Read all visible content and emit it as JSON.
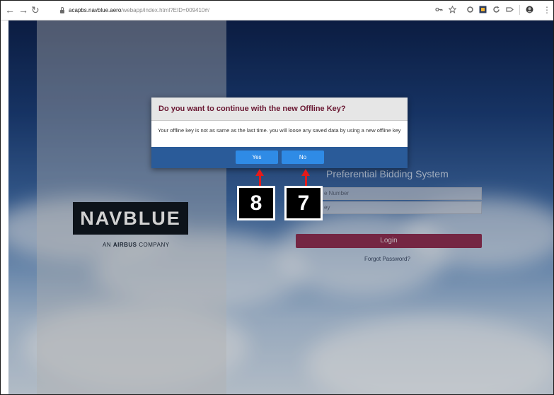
{
  "browser": {
    "url_host": "acapbs.navblue.aero",
    "url_path": "/webapp/index.html?EID=009410#/"
  },
  "brand": {
    "logo_text": "NAVBLUE",
    "tagline_prefix": "AN ",
    "tagline_bold": "AIRBUS",
    "tagline_suffix": " COMPANY"
  },
  "login": {
    "title": "Preferential Bidding System",
    "employee_field_placeholder": "e Number",
    "key_field_placeholder": "ey",
    "login_label": "Login",
    "forgot_label": "Forgot Password?"
  },
  "modal": {
    "title": "Do you want to continue with the new Offline Key?",
    "message": "Your offline key is not as same as the last time. you will loose any saved data by using a new offline key",
    "yes_label": "Yes",
    "no_label": "No"
  },
  "annotations": {
    "yes_step": "8",
    "no_step": "7",
    "color": "#e31b1b"
  },
  "colors": {
    "modal_title": "#6a1832",
    "modal_footer": "#2a5b99",
    "button": "#2f8be6",
    "login_button": "#8e2f52"
  }
}
